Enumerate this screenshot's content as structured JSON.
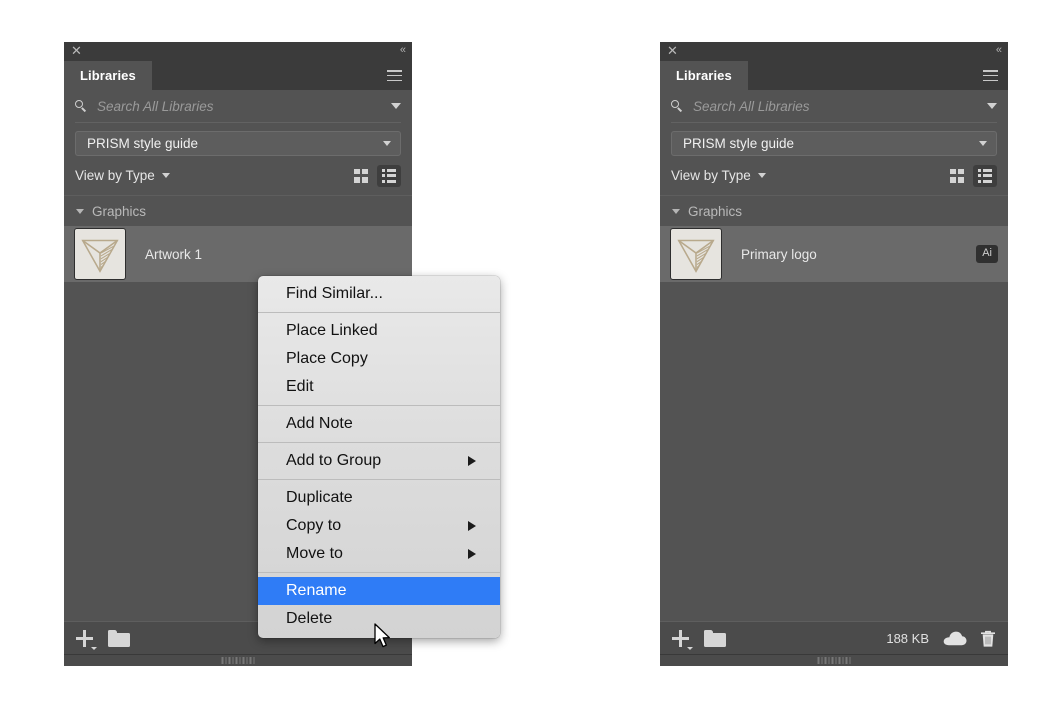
{
  "panels": [
    {
      "id": "left",
      "titlebar": {
        "close_icon": "close-icon",
        "collapse_icon": "collapse-icons"
      },
      "tab": {
        "label": "Libraries",
        "menu_icon": "hamburger-menu-icon"
      },
      "search": {
        "placeholder": "Search All Libraries",
        "icon": "search-icon",
        "chevron": "chevron-down-icon"
      },
      "library_select": {
        "value": "PRISM style guide",
        "chevron": "chevron-down-icon"
      },
      "view": {
        "label": "View by Type",
        "chevron": "chevron-down-icon",
        "grid_icon": "grid-view-icon",
        "list_icon": "list-view-icon",
        "active_view": "list"
      },
      "section": {
        "label": "Graphics",
        "disclosure": "chevron-down-icon"
      },
      "asset": {
        "name": "Artwork 1",
        "thumbnail": "primary-logo-thumbnail",
        "badge": ""
      },
      "bottom": {
        "add_icon": "add-icon",
        "folder_icon": "new-group-folder-icon",
        "size": "",
        "cloud_icon": "",
        "trash_icon": ""
      }
    },
    {
      "id": "right",
      "titlebar": {
        "close_icon": "close-icon",
        "collapse_icon": "collapse-icons"
      },
      "tab": {
        "label": "Libraries",
        "menu_icon": "hamburger-menu-icon"
      },
      "search": {
        "placeholder": "Search All Libraries",
        "icon": "search-icon",
        "chevron": "chevron-down-icon"
      },
      "library_select": {
        "value": "PRISM style guide",
        "chevron": "chevron-down-icon"
      },
      "view": {
        "label": "View by Type",
        "chevron": "chevron-down-icon",
        "grid_icon": "grid-view-icon",
        "list_icon": "list-view-icon",
        "active_view": "list"
      },
      "section": {
        "label": "Graphics",
        "disclosure": "chevron-down-icon"
      },
      "asset": {
        "name": "Primary logo",
        "thumbnail": "primary-logo-thumbnail",
        "badge": "Ai"
      },
      "bottom": {
        "add_icon": "add-icon",
        "folder_icon": "new-group-folder-icon",
        "size": "188 KB",
        "cloud_icon": "cloud-sync-icon",
        "trash_icon": "delete-icon"
      }
    }
  ],
  "context_menu": {
    "groups": [
      [
        {
          "label": "Find Similar...",
          "submenu": false,
          "selected": false
        }
      ],
      [
        {
          "label": "Place Linked",
          "submenu": false,
          "selected": false
        },
        {
          "label": "Place Copy",
          "submenu": false,
          "selected": false
        },
        {
          "label": "Edit",
          "submenu": false,
          "selected": false
        }
      ],
      [
        {
          "label": "Add Note",
          "submenu": false,
          "selected": false
        }
      ],
      [
        {
          "label": "Add to Group",
          "submenu": true,
          "selected": false
        }
      ],
      [
        {
          "label": "Duplicate",
          "submenu": false,
          "selected": false
        },
        {
          "label": "Copy to",
          "submenu": true,
          "selected": false
        },
        {
          "label": "Move to",
          "submenu": true,
          "selected": false
        }
      ],
      [
        {
          "label": "Rename",
          "submenu": false,
          "selected": true
        },
        {
          "label": "Delete",
          "submenu": false,
          "selected": false
        }
      ]
    ],
    "highlight_color": "#2f7cf6"
  },
  "colors": {
    "panel_bg": "#535353",
    "panel_chrome": "#3b3b3b",
    "row_selected": "#6a6a6a",
    "accent_blue": "#2f7cf6",
    "logo_tan": "#b8a98c"
  },
  "cursor": {
    "icon": "arrow-pointer-cursor"
  }
}
